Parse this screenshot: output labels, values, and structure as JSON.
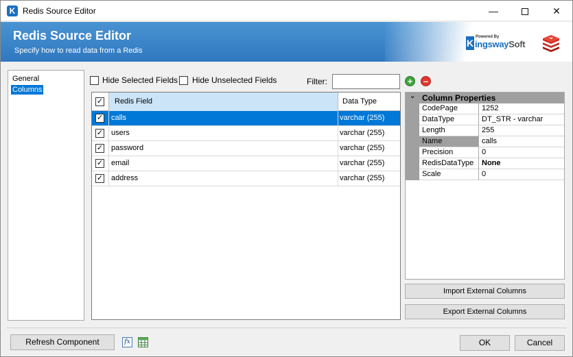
{
  "window": {
    "title": "Redis Source Editor",
    "minimize_glyph": "—",
    "close_glyph": "✕"
  },
  "banner": {
    "title": "Redis Source Editor",
    "subtitle": "Specify how to read data from a Redis",
    "logo_powered": "Powered By",
    "logo_k": "K",
    "logo_name_1": "ingsway",
    "logo_name_2": "Soft"
  },
  "nav": {
    "items": [
      {
        "label": "General",
        "selected": false
      },
      {
        "label": "Columns",
        "selected": true
      }
    ]
  },
  "toolbar": {
    "hide_selected": "Hide Selected Fields",
    "hide_unselected": "Hide Unselected Fields",
    "filter_label": "Filter:",
    "filter_value": "",
    "add_glyph": "+",
    "remove_glyph": "–"
  },
  "grid": {
    "header_check": "✓",
    "col_field": "Redis Field",
    "col_type": "Data Type",
    "rows": [
      {
        "checked": "✓",
        "field": "calls",
        "type": "varchar (255)",
        "selected": true
      },
      {
        "checked": "✓",
        "field": "users",
        "type": "varchar (255)",
        "selected": false
      },
      {
        "checked": "✓",
        "field": "password",
        "type": "varchar (255)",
        "selected": false
      },
      {
        "checked": "✓",
        "field": "email",
        "type": "varchar (255)",
        "selected": false
      },
      {
        "checked": "✓",
        "field": "address",
        "type": "varchar (255)",
        "selected": false
      }
    ]
  },
  "properties": {
    "header": "Column Properties",
    "collapse_glyph": "⌄",
    "rows": [
      {
        "name": "CodePage",
        "value": "1252"
      },
      {
        "name": "DataType",
        "value": "DT_STR - varchar"
      },
      {
        "name": "Length",
        "value": "255"
      },
      {
        "name": "Name",
        "value": "calls"
      },
      {
        "name": "Precision",
        "value": "0"
      },
      {
        "name": "RedisDataType",
        "value": "None"
      },
      {
        "name": "Scale",
        "value": "0"
      }
    ]
  },
  "buttons": {
    "import": "Import External Columns",
    "export": "Export External Columns",
    "refresh": "Refresh Component",
    "ok": "OK",
    "cancel": "Cancel",
    "fx_glyph": "fx"
  },
  "colors": {
    "banner_blue": "#2f78c0",
    "selection_blue": "#0078d7",
    "header_highlight": "#cce4f7",
    "prop_gutter": "#a0a0a0",
    "add_green": "#3da33a",
    "remove_red": "#e0382f"
  }
}
